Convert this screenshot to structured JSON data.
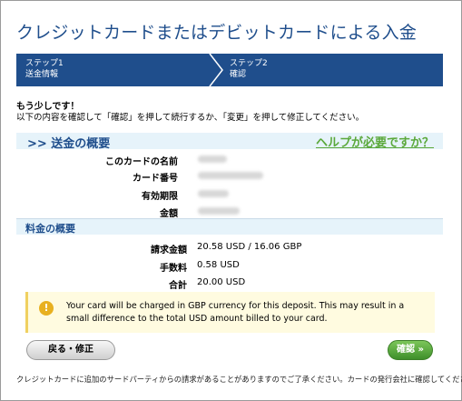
{
  "page": {
    "title": "クレジットカードまたはデビットカードによる入金"
  },
  "steps": [
    {
      "number": "ステップ1",
      "label": "送金情報"
    },
    {
      "number": "ステップ2",
      "label": "確認"
    }
  ],
  "intro": {
    "heading": "もう少しです！",
    "text": "以下の内容を確認して「確認」を押して続行するか、「変更」を押して修正してください。"
  },
  "summary": {
    "title": ">> 送金の概要",
    "help_link": "ヘルプが必要ですか？",
    "rows": [
      {
        "label": "このカードの名前"
      },
      {
        "label": "カード番号"
      },
      {
        "label": "有効期限"
      },
      {
        "label": "金額"
      }
    ]
  },
  "fees": {
    "title": "料金の概要",
    "rows": [
      {
        "label": "請求金額",
        "value": "20.58 USD / 16.06 GBP"
      },
      {
        "label": "手数料",
        "value": "0.58 USD"
      },
      {
        "label": "合計",
        "value": "20.00 USD"
      }
    ]
  },
  "notice": {
    "icon": "info-icon",
    "text": "Your card will be charged in GBP currency for this deposit. This may result in a small difference to the total USD amount billed to your card."
  },
  "buttons": {
    "back": "戻る・修正",
    "confirm": "確認 »"
  },
  "footer": "クレジットカードに追加のサードパーティからの請求があることがありますのでご了承ください。カードの発行会社に確認してください。",
  "colors": {
    "brand": "#1f4e8c",
    "help": "#5aa83a",
    "confirm": "#3e8f2a"
  }
}
